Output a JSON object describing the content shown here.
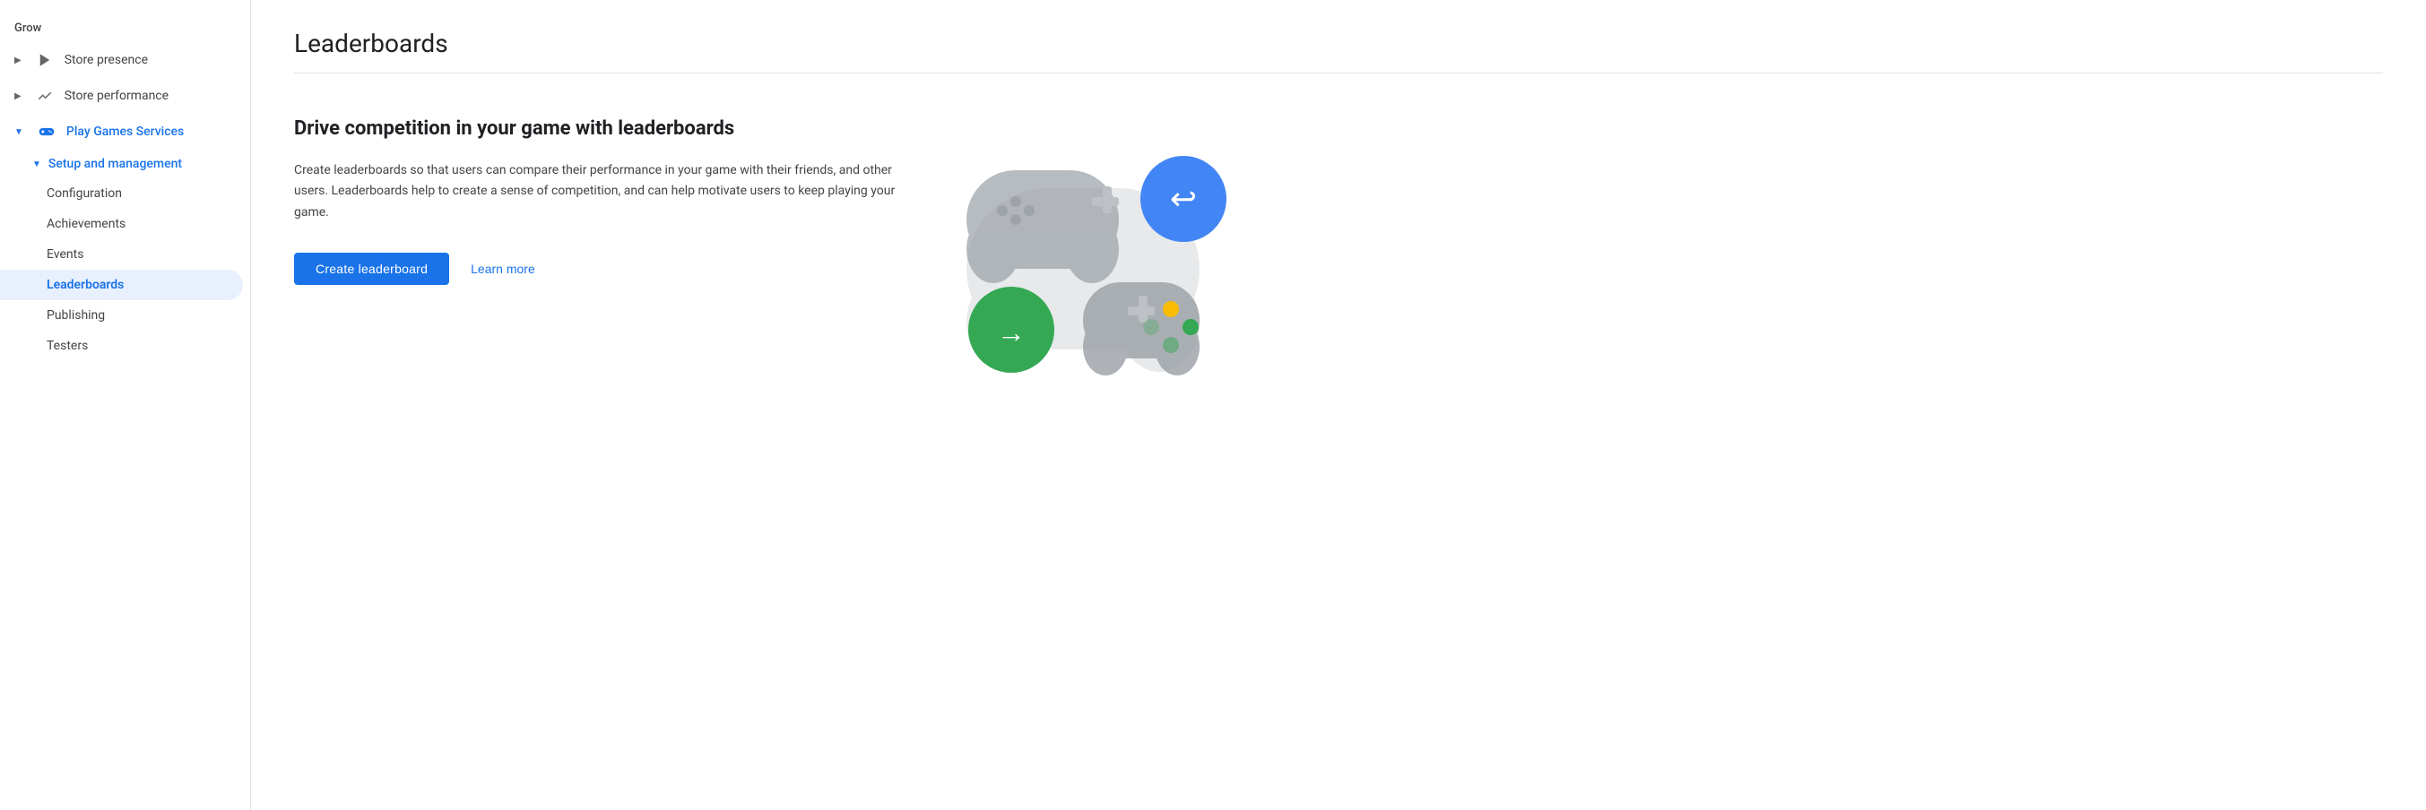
{
  "sidebar": {
    "grow_label": "Grow",
    "items": [
      {
        "id": "store-presence",
        "label": "Store presence",
        "icon": "play-icon",
        "expanded": false,
        "active": false
      },
      {
        "id": "store-performance",
        "label": "Store performance",
        "icon": "trending-up-icon",
        "expanded": false,
        "active": false
      },
      {
        "id": "play-games-services",
        "label": "Play Games Services",
        "icon": "gamepad-icon",
        "expanded": true,
        "active": true
      }
    ],
    "sub_section": {
      "label": "Setup and management",
      "items": [
        {
          "id": "configuration",
          "label": "Configuration",
          "active": false
        },
        {
          "id": "achievements",
          "label": "Achievements",
          "active": false
        },
        {
          "id": "events",
          "label": "Events",
          "active": false
        },
        {
          "id": "leaderboards",
          "label": "Leaderboards",
          "active": true
        },
        {
          "id": "publishing",
          "label": "Publishing",
          "active": false
        },
        {
          "id": "testers",
          "label": "Testers",
          "active": false
        }
      ]
    }
  },
  "main": {
    "page_title": "Leaderboards",
    "section_heading": "Drive competition in your game with leaderboards",
    "section_body": "Create leaderboards so that users can compare their performance in your game with their friends, and other users. Leaderboards help to create a sense of competition, and can help motivate users to keep playing your game.",
    "create_button": "Create leaderboard",
    "learn_more": "Learn more"
  }
}
